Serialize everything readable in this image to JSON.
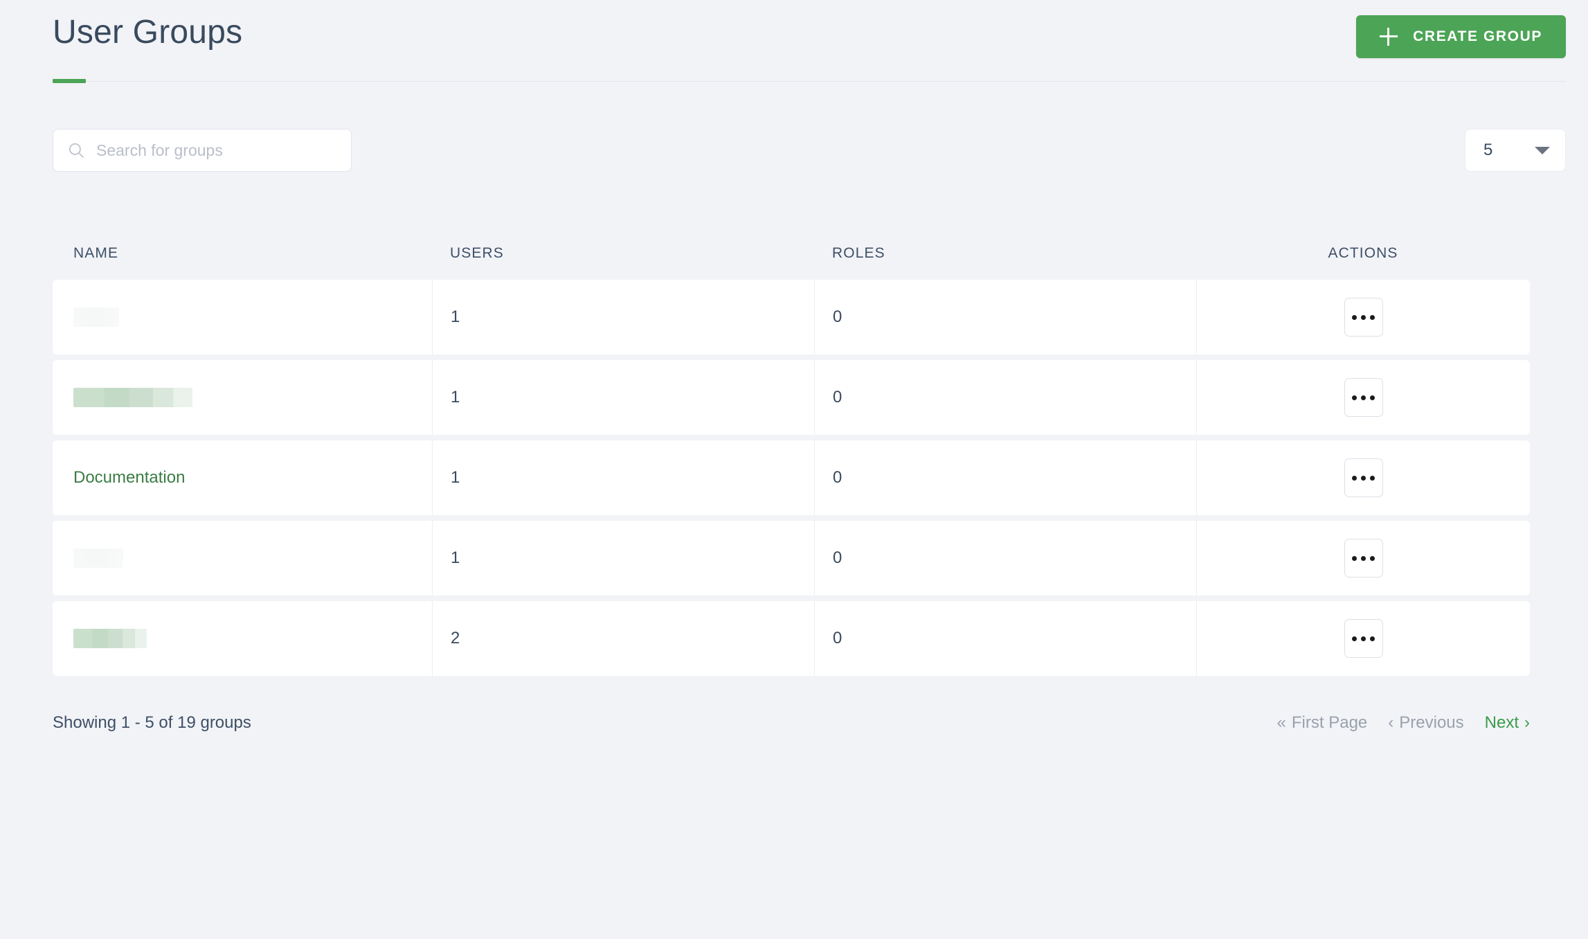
{
  "header": {
    "title": "User Groups",
    "create_button_label": "CREATE GROUP",
    "create_button_icon": "plus-icon",
    "accent_color": "#4ca456"
  },
  "toolbar": {
    "search_placeholder": "Search for groups",
    "search_value": "",
    "search_icon": "search-icon",
    "page_size_value": "5",
    "page_size_icon": "caret-down-icon"
  },
  "table": {
    "columns": [
      "NAME",
      "USERS",
      "ROLES",
      "ACTIONS"
    ],
    "rows": [
      {
        "name": "",
        "redacted": "light",
        "users": "1",
        "roles": "0",
        "actions_icon": "ellipsis-icon"
      },
      {
        "name": "",
        "redacted": "green",
        "users": "1",
        "roles": "0",
        "actions_icon": "ellipsis-icon"
      },
      {
        "name": "Documentation",
        "redacted": null,
        "users": "1",
        "roles": "0",
        "actions_icon": "ellipsis-icon"
      },
      {
        "name": "",
        "redacted": "light",
        "users": "1",
        "roles": "0",
        "actions_icon": "ellipsis-icon"
      },
      {
        "name": "",
        "redacted": "green",
        "users": "2",
        "roles": "0",
        "actions_icon": "ellipsis-icon"
      }
    ]
  },
  "footer": {
    "showing_text": "Showing 1 - 5 of 19 groups",
    "first_page_label": "First Page",
    "previous_label": "Previous",
    "next_label": "Next",
    "first_page_icon": "double-chevron-left-icon",
    "previous_icon": "chevron-left-icon",
    "next_icon": "chevron-right-icon",
    "link_color": "#3a9c48",
    "disabled_color": "#9aa1ac"
  }
}
